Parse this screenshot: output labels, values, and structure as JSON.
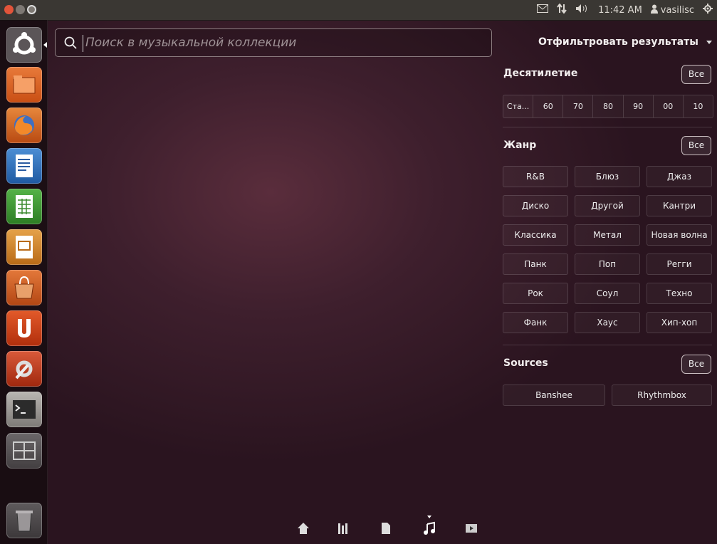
{
  "topbar": {
    "indicators": [
      "mail-icon",
      "network-icon",
      "sound-icon"
    ],
    "clock": "11:42 AM",
    "user": "vasilisc"
  },
  "launcher": {
    "items": [
      "ubuntu-dash-icon",
      "files-icon",
      "firefox-icon",
      "writer-icon",
      "calc-icon",
      "impress-icon",
      "software-center-icon",
      "ubuntu-one-icon",
      "system-settings-icon",
      "terminal-icon",
      "workspaces-icon",
      "trash-icon"
    ]
  },
  "search": {
    "placeholder": "Поиск в музыкальной коллекции"
  },
  "filters": {
    "title": "Отфильтровать результаты",
    "decade": {
      "title": "Десятилетие",
      "all": "Все",
      "options": [
        "Ста...",
        "60",
        "70",
        "80",
        "90",
        "00",
        "10"
      ]
    },
    "genre": {
      "title": "Жанр",
      "all": "Все",
      "options": [
        "R&B",
        "Блюз",
        "Джаз",
        "Диско",
        "Другой",
        "Кантри",
        "Классика",
        "Метал",
        "Новая волна",
        "Панк",
        "Поп",
        "Регги",
        "Рок",
        "Соул",
        "Техно",
        "Фанк",
        "Хаус",
        "Хип-хоп"
      ]
    },
    "sources": {
      "title": "Sources",
      "all": "Все",
      "options": [
        "Banshee",
        "Rhythmbox"
      ]
    }
  },
  "lens_bar": {
    "items": [
      "home-lens-icon",
      "apps-lens-icon",
      "files-lens-icon",
      "music-lens-icon",
      "video-lens-icon"
    ],
    "active": "music-lens-icon"
  }
}
